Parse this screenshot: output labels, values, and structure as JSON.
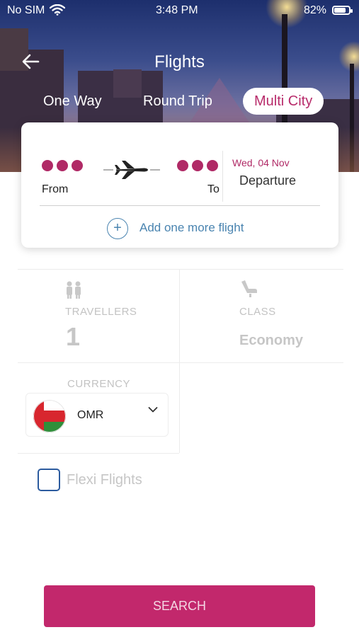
{
  "status_bar": {
    "carrier": "No SIM",
    "time": "3:48 PM",
    "battery": "82%",
    "battery_level": 0.82
  },
  "header": {
    "title": "Flights",
    "back_icon": "arrow-left-icon"
  },
  "trip_tabs": [
    {
      "label": "One Way",
      "active": false
    },
    {
      "label": "Round Trip",
      "active": false
    },
    {
      "label": "Multi City",
      "active": true
    }
  ],
  "flight_card": {
    "from_label": "From",
    "to_label": "To",
    "date": "Wed, 04 Nov",
    "date_label": "Departure",
    "add_label": "Add one more flight",
    "plane_icon": "airplane-icon"
  },
  "travellers": {
    "label": "TRAVELLERS",
    "value": "1",
    "icon": "people-icon"
  },
  "class": {
    "label": "CLASS",
    "value": "Economy",
    "icon": "seat-icon"
  },
  "currency": {
    "label": "CURRENCY",
    "value": "OMR",
    "flag": "oman-flag-icon"
  },
  "flexi": {
    "label": "Flexi Flights",
    "checked": false
  },
  "search_label": "SEARCH",
  "colors": {
    "accent": "#c2286c",
    "link": "#4a84b0",
    "checkbox": "#2c5b9e"
  }
}
